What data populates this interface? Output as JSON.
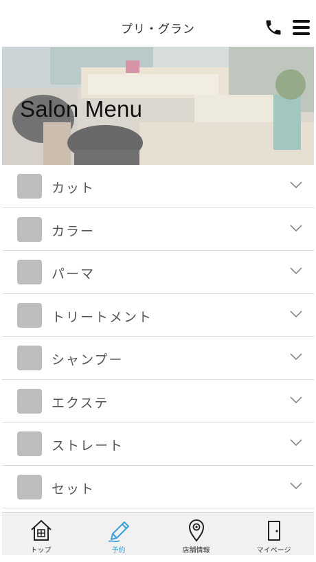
{
  "header": {
    "title": "プリ・グラン",
    "icons": {
      "phone": "phone-icon",
      "menu": "hamburger-menu-icon"
    }
  },
  "hero": {
    "title": "Salon Menu"
  },
  "menu": {
    "items": [
      {
        "label": "カット"
      },
      {
        "label": "カラー"
      },
      {
        "label": "パーマ"
      },
      {
        "label": "トリートメント"
      },
      {
        "label": "シャンプー"
      },
      {
        "label": "エクステ"
      },
      {
        "label": "ストレート"
      },
      {
        "label": "セット"
      }
    ]
  },
  "tabbar": {
    "active_color": "#3aa0d8",
    "tabs": [
      {
        "label": "トップ",
        "icon": "home-icon"
      },
      {
        "label": "予約",
        "icon": "pencil-icon",
        "active": true
      },
      {
        "label": "店舗情報",
        "icon": "map-pin-icon"
      },
      {
        "label": "マイページ",
        "icon": "door-icon"
      }
    ]
  }
}
